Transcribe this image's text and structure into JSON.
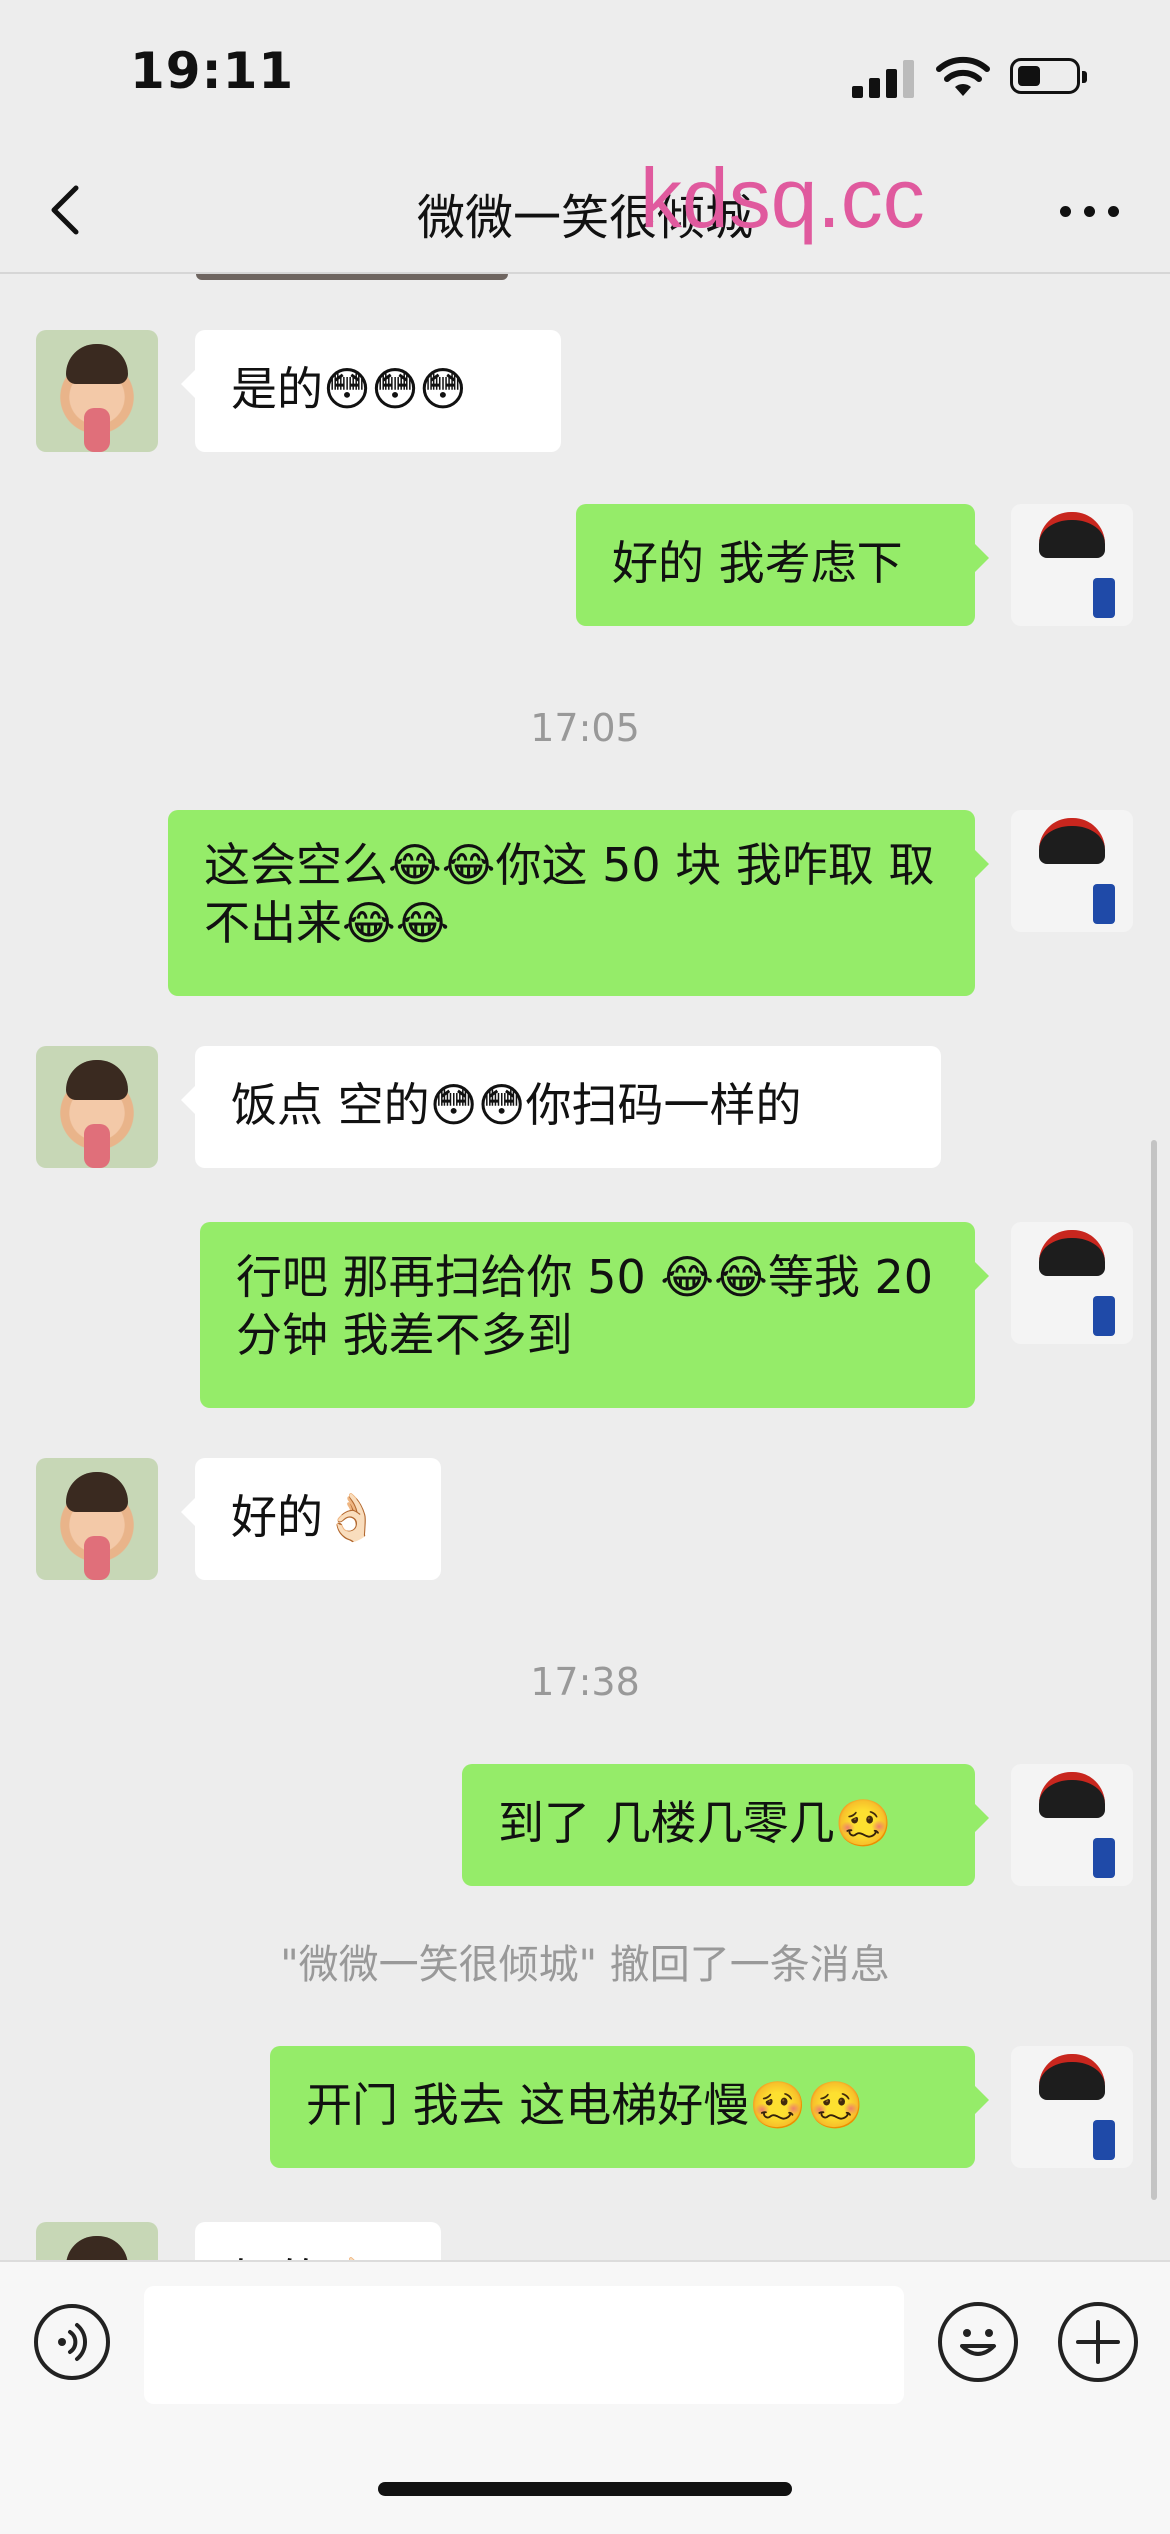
{
  "status_bar": {
    "time": "19:11"
  },
  "header": {
    "title": "微微一笑很倾城",
    "watermark": "kdsq.cc"
  },
  "messages": [
    {
      "from": "them",
      "text": "是的😳😳😳"
    },
    {
      "from": "me",
      "text": "好的 我考虑下"
    },
    {
      "type": "time",
      "text": "17:05"
    },
    {
      "from": "me",
      "text": "这会空么😂😂你这 50 块 我咋取 取不出来😂😂"
    },
    {
      "from": "them",
      "text": "饭点 空的😳😳你扫码一样的"
    },
    {
      "from": "me",
      "text": "行吧 那再扫给你 50 😂😂等我 20 分钟 我差不多到"
    },
    {
      "from": "them",
      "text": "好的👌🏻"
    },
    {
      "type": "time",
      "text": "17:38"
    },
    {
      "from": "me",
      "text": "到了 几楼几零几🥴"
    },
    {
      "type": "system",
      "text": "\"微微一笑很倾城\" 撤回了一条消息"
    },
    {
      "from": "me",
      "text": "开门 我去 这电梯好慢🥴🥴"
    },
    {
      "from": "them",
      "text": "好的👌🏻",
      "partial": true
    }
  ],
  "input": {
    "value": "",
    "placeholder": ""
  },
  "icons": {
    "back": "chevron-left-icon",
    "more": "more-dots-icon",
    "voice": "voice-icon",
    "emoji": "emoji-icon",
    "plus": "plus-icon"
  }
}
